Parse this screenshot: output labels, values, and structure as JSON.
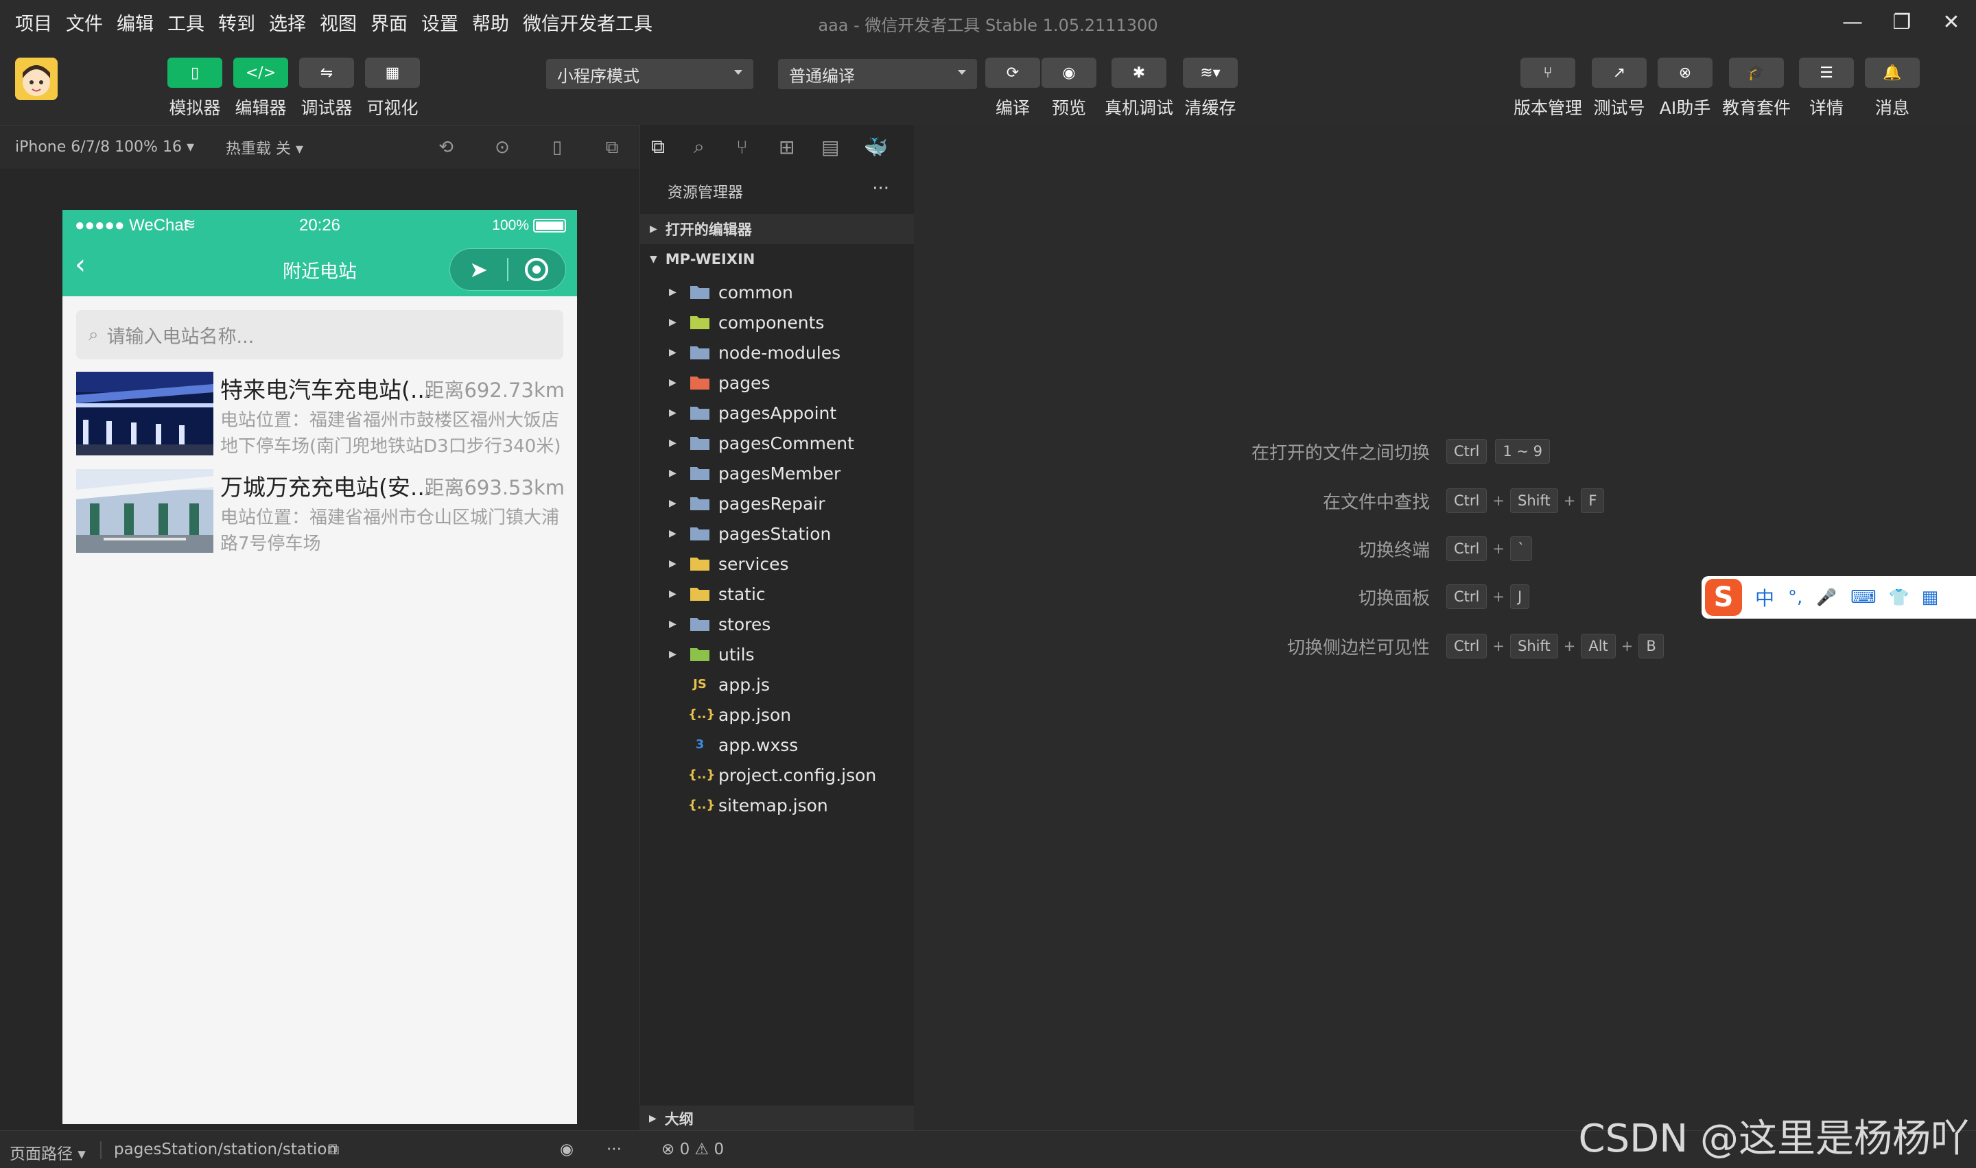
{
  "menu": [
    "项目",
    "文件",
    "编辑",
    "工具",
    "转到",
    "选择",
    "视图",
    "界面",
    "设置",
    "帮助",
    "微信开发者工具"
  ],
  "window_title": "aaa - 微信开发者工具 Stable 1.05.2111300",
  "toolbar": {
    "left_buttons": [
      {
        "label": "模拟器",
        "icon": "phone-icon"
      },
      {
        "label": "编辑器",
        "icon": "code-icon"
      },
      {
        "label": "调试器",
        "icon": "debug-icon"
      },
      {
        "label": "可视化",
        "icon": "layout-icon"
      }
    ],
    "mode_select": "小程序模式",
    "compile_select": "普通编译",
    "center_buttons": [
      {
        "label": "编译",
        "icon": "refresh-icon"
      },
      {
        "label": "预览",
        "icon": "eye-icon"
      },
      {
        "label": "真机调试",
        "icon": "bug-icon"
      },
      {
        "label": "清缓存",
        "icon": "layers-icon"
      }
    ],
    "right_buttons": [
      {
        "label": "版本管理",
        "icon": "branch-icon"
      },
      {
        "label": "测试号",
        "icon": "external-link-icon"
      },
      {
        "label": "AI助手",
        "icon": "ai-icon"
      },
      {
        "label": "教育套件",
        "icon": "graduation-cap-icon"
      },
      {
        "label": "详情",
        "icon": "menu-icon"
      },
      {
        "label": "消息",
        "icon": "bell-icon"
      }
    ]
  },
  "simbar": {
    "device": "iPhone 6/7/8 100% 16 ▾",
    "hot_reload": "热重载 关 ▾"
  },
  "phone": {
    "status_left": "●●●●● WeChat",
    "status_time": "20:26",
    "status_battery": "100%",
    "nav_title": "附近电站",
    "search_placeholder": "请输入电站名称...",
    "stations": [
      {
        "name": "特来电汽车充电站(...",
        "distance": "距离692.73km",
        "address": "电站位置：福建省福州市鼓楼区福州大饭店地下停车场(南门兜地铁站D3口步行340米)"
      },
      {
        "name": "万城万充充电站(安...",
        "distance": "距离693.53km",
        "address": "电站位置：福建省福州市仓山区城门镇大浦路7号停车场"
      }
    ]
  },
  "explorer": {
    "title": "资源管理器",
    "more": "···",
    "open_editors": "打开的编辑器",
    "project": "MP-WEIXIN",
    "folders": [
      {
        "name": "common",
        "color": "#8aa4c8"
      },
      {
        "name": "components",
        "color": "#b5cf4a"
      },
      {
        "name": "node-modules",
        "color": "#8aa4c8"
      },
      {
        "name": "pages",
        "color": "#e66a4c"
      },
      {
        "name": "pagesAppoint",
        "color": "#8aa4c8"
      },
      {
        "name": "pagesComment",
        "color": "#8aa4c8"
      },
      {
        "name": "pagesMember",
        "color": "#8aa4c8"
      },
      {
        "name": "pagesRepair",
        "color": "#8aa4c8"
      },
      {
        "name": "pagesStation",
        "color": "#8aa4c8"
      },
      {
        "name": "services",
        "color": "#e8c14a"
      },
      {
        "name": "static",
        "color": "#e8c14a"
      },
      {
        "name": "stores",
        "color": "#8aa4c8"
      },
      {
        "name": "utils",
        "color": "#8dc24a"
      }
    ],
    "files": [
      {
        "name": "app.js",
        "glyph": "JS",
        "color": "#e8c14a"
      },
      {
        "name": "app.json",
        "glyph": "{..}",
        "color": "#e8c14a"
      },
      {
        "name": "app.wxss",
        "glyph": "3",
        "color": "#3b8de0"
      },
      {
        "name": "project.config.json",
        "glyph": "{..}",
        "color": "#e8c14a"
      },
      {
        "name": "sitemap.json",
        "glyph": "{..}",
        "color": "#e8c14a"
      }
    ],
    "outline": "大纲"
  },
  "hints": [
    {
      "text": "在打开的文件之间切换",
      "keys": [
        "Ctrl",
        "1 ~ 9"
      ],
      "sep": [
        ""
      ]
    },
    {
      "text": "在文件中查找",
      "keys": [
        "Ctrl",
        "Shift",
        "F"
      ]
    },
    {
      "text": "切换终端",
      "keys": [
        "Ctrl",
        "`"
      ]
    },
    {
      "text": "切换面板",
      "keys": [
        "Ctrl",
        "J"
      ]
    },
    {
      "text": "切换侧边栏可见性",
      "keys": [
        "Ctrl",
        "Shift",
        "Alt",
        "B"
      ]
    }
  ],
  "bottom": {
    "page_path_label": "页面路径 ▾",
    "page_path": "pagesStation/station/station",
    "problems": "⊗ 0 ⚠ 0"
  },
  "ime": [
    "中",
    "°,",
    "🎤",
    "⌨",
    "👕",
    "▦"
  ],
  "watermark": "CSDN @这里是杨杨吖",
  "colors": {
    "accent_green": "#2ec49a",
    "button_green": "#12b563"
  }
}
